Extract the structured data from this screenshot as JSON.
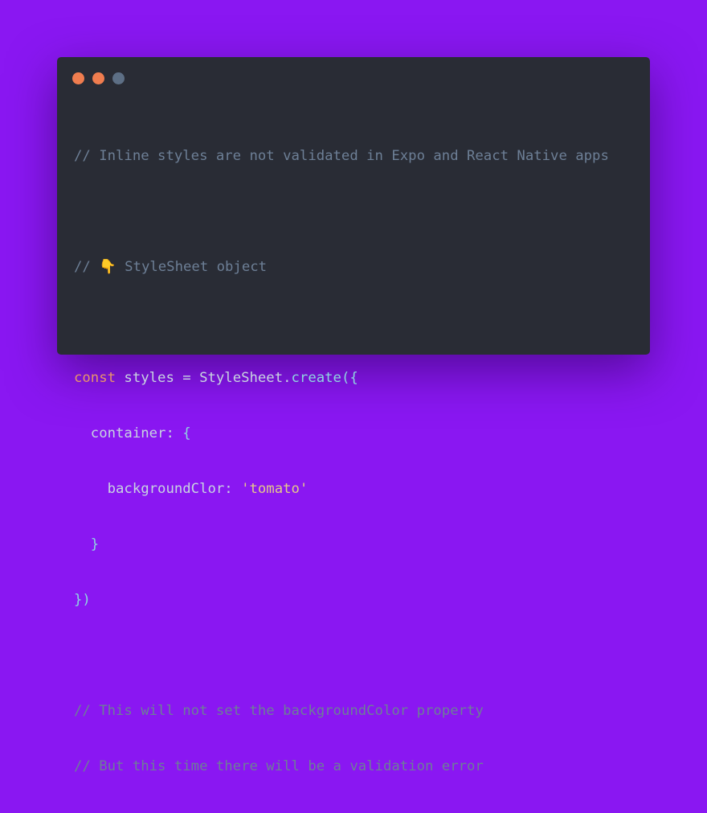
{
  "window": {
    "dots": [
      {
        "name": "close-dot",
        "color": "#ef7d4f"
      },
      {
        "name": "minimize-dot",
        "color": "#ef7d4f"
      },
      {
        "name": "maximize-dot",
        "color": "#5d6f85"
      }
    ]
  },
  "code": {
    "line1": "// Inline styles are not validated in Expo and React Native apps",
    "line3_prefix": "// ",
    "line3_emoji": "👇",
    "line3_text": " StyleSheet object",
    "line5_keyword": "const",
    "line5_var": " styles = ",
    "line5_class": "StyleSheet",
    "line5_dot": ".",
    "line5_method": "create",
    "line5_open": "({",
    "line6_key": "  container: ",
    "line6_brace": "{",
    "line7_key": "    backgroundClor: ",
    "line7_string": "'tomato'",
    "line8_brace": "  }",
    "line9_close": "})",
    "line11": "// This will not set the backgroundColor property",
    "line12": "// But this time there will be a validation error"
  },
  "colors": {
    "background": "#8a17f2",
    "card": "#292c35",
    "comment": "#6d7f96",
    "keyword": "#e8946a",
    "method": "#8fd5e0",
    "string": "#e4c98a"
  }
}
